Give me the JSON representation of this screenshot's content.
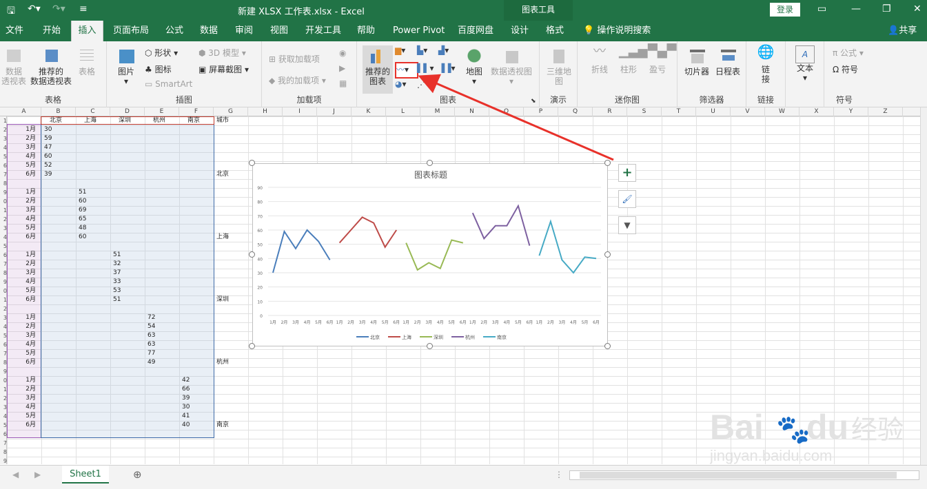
{
  "titlebar": {
    "title": "新建 XLSX 工作表.xlsx  -  Excel",
    "chart_tools": "图表工具",
    "login": "登录"
  },
  "tabs": [
    "文件",
    "开始",
    "插入",
    "页面布局",
    "公式",
    "数据",
    "审阅",
    "视图",
    "开发工具",
    "帮助",
    "Power Pivot",
    "百度网盘",
    "设计",
    "格式"
  ],
  "tell_me": "操作说明搜索",
  "share": "共享",
  "ribbon": {
    "groups": {
      "tables": "表格",
      "illustrations": "插图",
      "addins": "加载项",
      "charts": "图表",
      "tours": "演示",
      "sparklines": "迷你图",
      "filters": "筛选器",
      "links": "链接",
      "symbols": "符号"
    },
    "pivot_table": "数据\n透视表",
    "recommended_pivot": "推荐的\n数据透视表",
    "table": "表格",
    "pictures": "图片",
    "shapes": "形状",
    "icons": "图标",
    "model3d": "3D 模型",
    "smartart": "SmartArt",
    "screenshot": "屏幕截图",
    "get_addins": "获取加载项",
    "my_addins": "我的加载项",
    "recommended_charts": "推荐的\n图表",
    "maps": "地图",
    "pivot_chart": "数据透视图",
    "map3d": "三维地\n图",
    "line": "折线",
    "column": "柱形",
    "winloss": "盈亏",
    "slicer": "切片器",
    "timeline": "日程表",
    "link": "链\n接",
    "text": "文本",
    "equation": "公式",
    "symbol": "符号"
  },
  "columns": [
    "A",
    "B",
    "C",
    "D",
    "E",
    "F",
    "G",
    "H",
    "I",
    "J",
    "K",
    "L",
    "M",
    "N",
    "O",
    "P",
    "Q",
    "R",
    "S",
    "T",
    "U",
    "V",
    "W",
    "X",
    "Y",
    "Z"
  ],
  "row_numbers": [
    "1",
    "2",
    "3",
    "4",
    "5",
    "6",
    "7",
    "8",
    "9",
    "0",
    "1",
    "2",
    "3",
    "4",
    "5",
    "6",
    "7",
    "8",
    "9",
    "0",
    "1",
    "2",
    "3",
    "4",
    "5",
    "6",
    "7",
    "8",
    "9",
    "0",
    "1",
    "2",
    "3",
    "4",
    "5",
    "6",
    "7",
    "8",
    "9"
  ],
  "sheet": {
    "headers": [
      "北京",
      "上海",
      "深圳",
      "杭州",
      "南京"
    ],
    "city_col_title": "城市",
    "months": [
      "1月",
      "2月",
      "3月",
      "4月",
      "5月",
      "6月"
    ],
    "blocks": [
      {
        "city": "北京",
        "values": [
          "30",
          "59",
          "47",
          "60",
          "52",
          "39"
        ]
      },
      {
        "city": "上海",
        "values": [
          "51",
          "60",
          "69",
          "65",
          "48",
          "60"
        ]
      },
      {
        "city": "深圳",
        "values": [
          "51",
          "32",
          "37",
          "33",
          "53",
          "51"
        ]
      },
      {
        "city": "杭州",
        "values": [
          "72",
          "54",
          "63",
          "63",
          "77",
          "49"
        ]
      },
      {
        "city": "南京",
        "values": [
          "42",
          "66",
          "39",
          "30",
          "41",
          "40"
        ]
      }
    ]
  },
  "chart_data": {
    "type": "line",
    "title": "图表标题",
    "categories": [
      "1月",
      "2月",
      "3月",
      "4月",
      "5月",
      "6月"
    ],
    "ylim": [
      0,
      90
    ],
    "yticks": [
      "0",
      "10",
      "20",
      "30",
      "40",
      "50",
      "60",
      "70",
      "80",
      "90"
    ],
    "series": [
      {
        "name": "北京",
        "color": "#4a7ebb",
        "values": [
          30,
          59,
          47,
          60,
          52,
          39
        ]
      },
      {
        "name": "上海",
        "color": "#be4b48",
        "values": [
          51,
          60,
          69,
          65,
          48,
          60
        ]
      },
      {
        "name": "深圳",
        "color": "#98b954",
        "values": [
          51,
          32,
          37,
          33,
          53,
          51
        ]
      },
      {
        "name": "杭州",
        "color": "#7d60a0",
        "values": [
          72,
          54,
          63,
          63,
          77,
          49
        ]
      },
      {
        "name": "南京",
        "color": "#46aac5",
        "values": [
          42,
          66,
          39,
          30,
          41,
          40
        ]
      }
    ],
    "legend_position": "bottom",
    "grid": true
  },
  "sheet_tab": "Sheet1",
  "colors": {
    "accent": "#217346",
    "highlight": "#e8312a"
  }
}
